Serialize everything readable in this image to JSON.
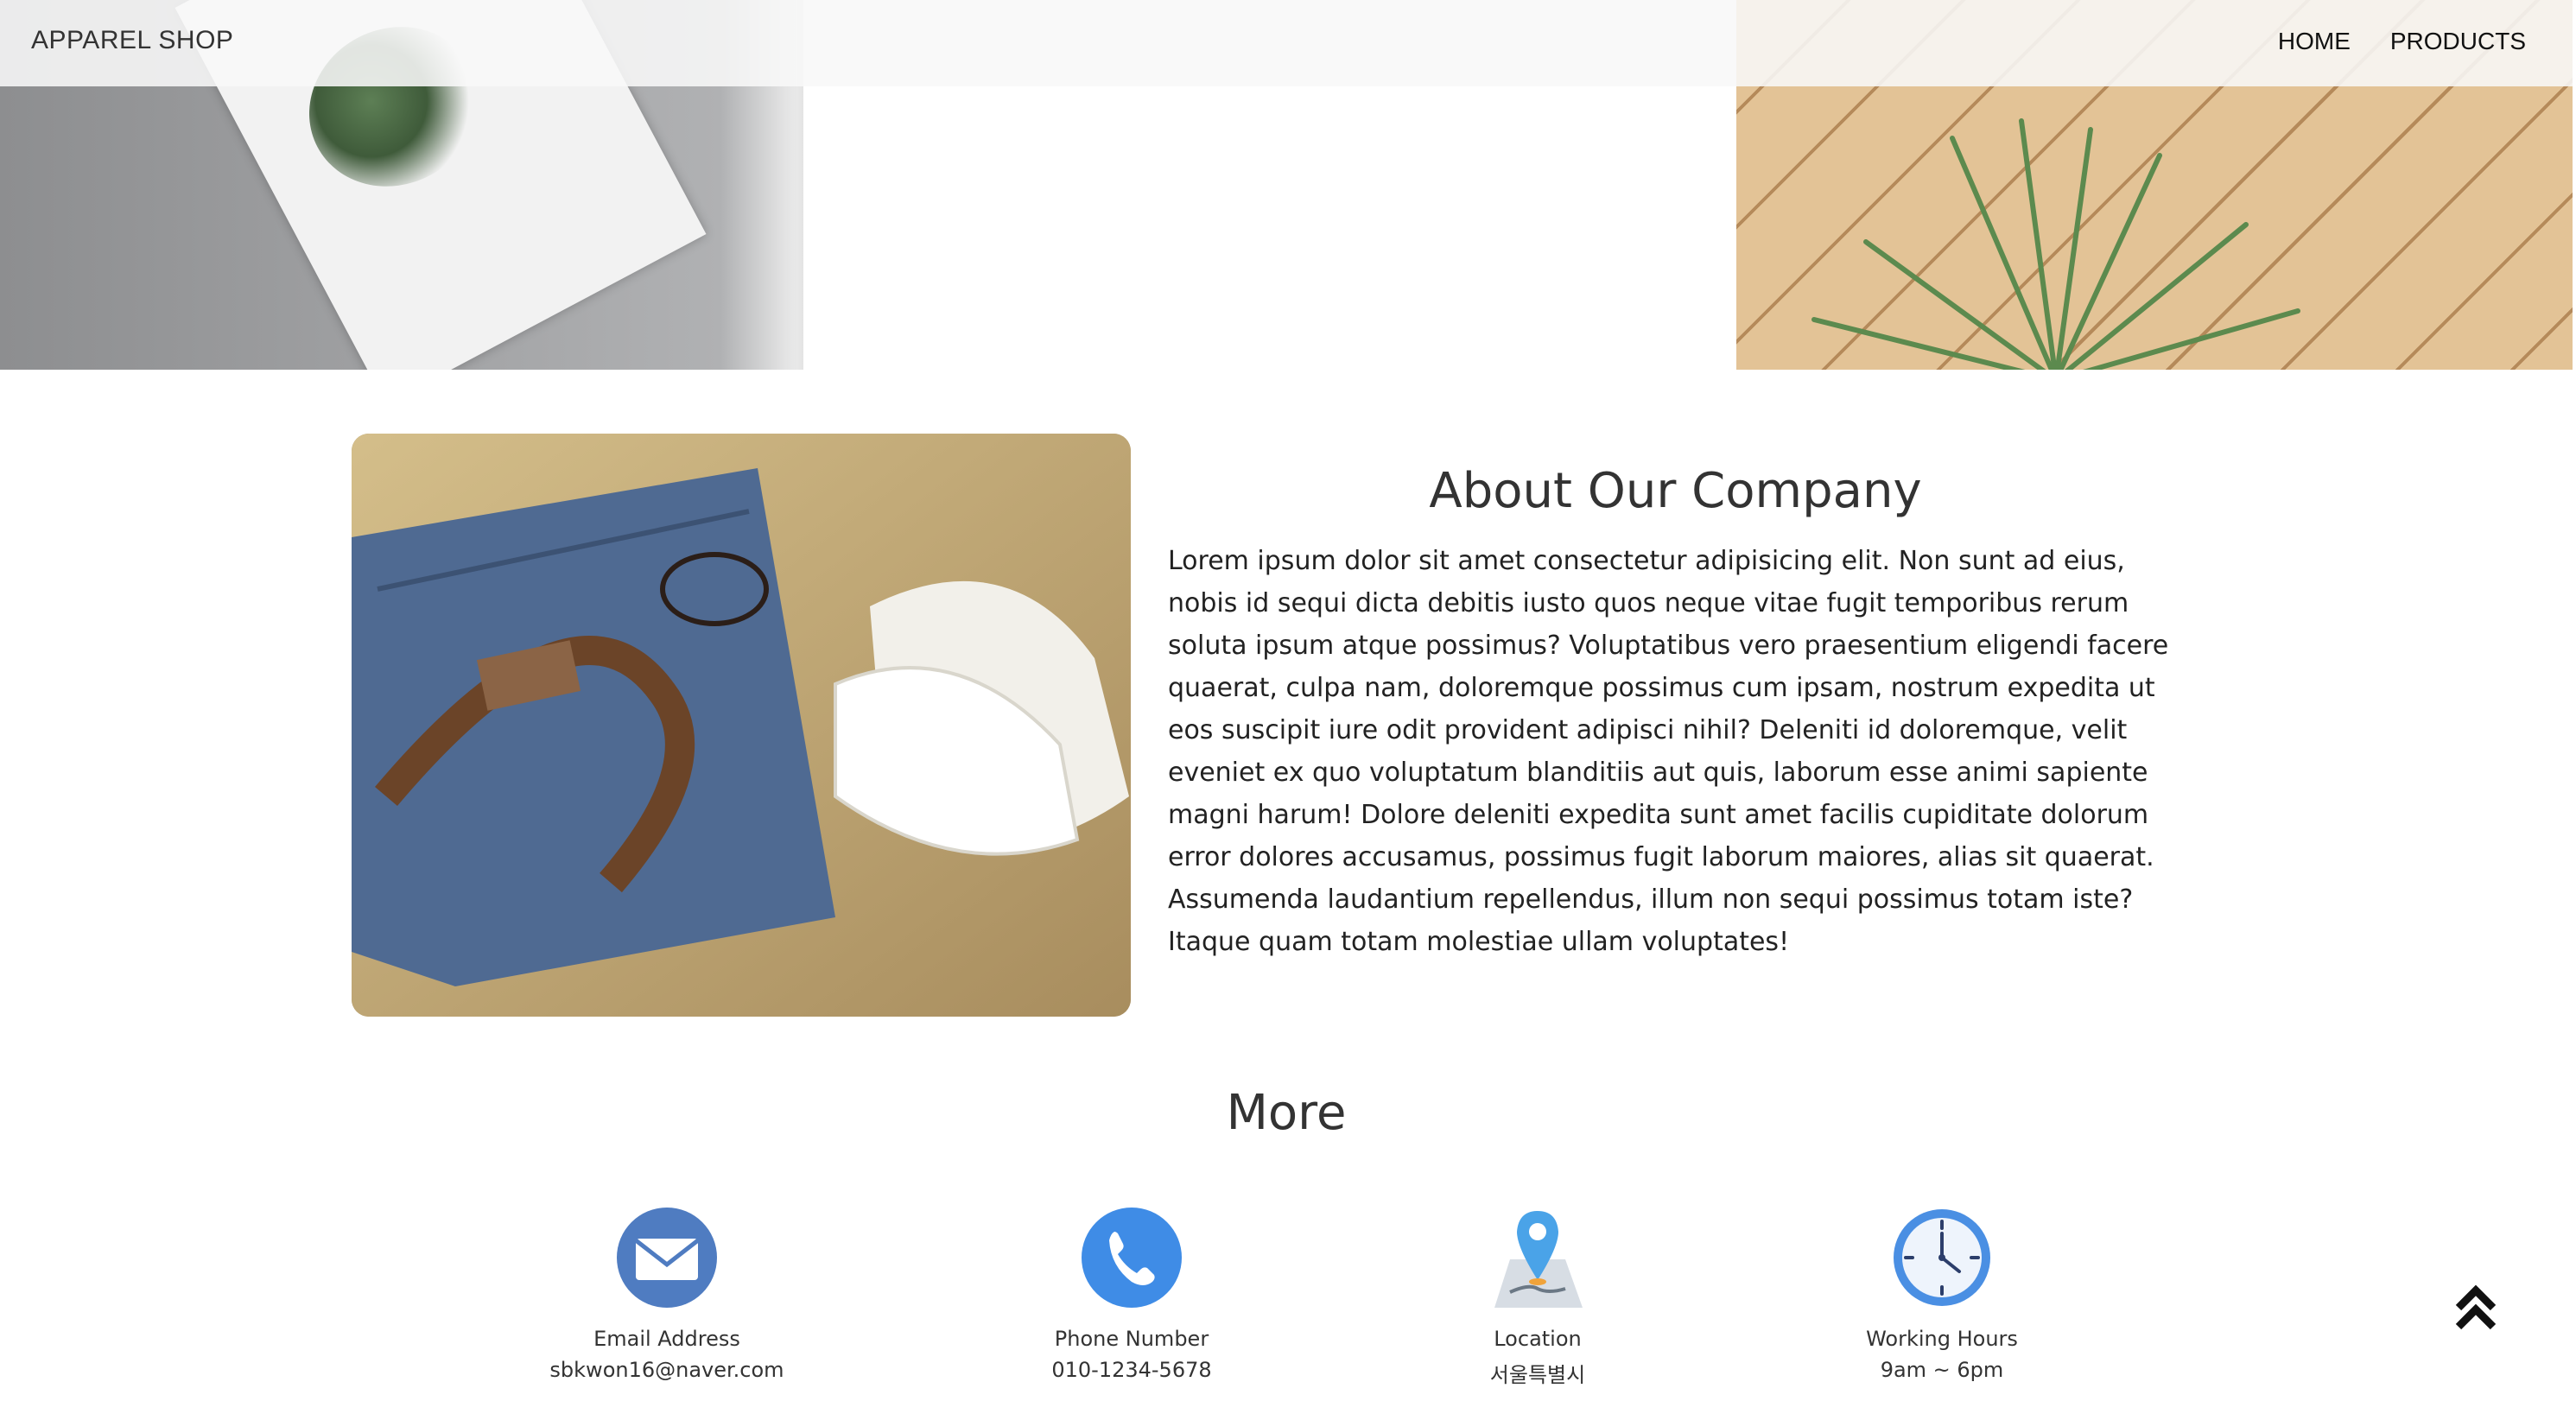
{
  "navbar": {
    "brand": "APPAREL SHOP",
    "links": [
      "HOME",
      "PRODUCTS"
    ]
  },
  "about": {
    "title": "About Our Company",
    "body": "Lorem ipsum dolor sit amet consectetur adipisicing elit. Non sunt ad eius, nobis id sequi dicta debitis iusto quos neque vitae fugit temporibus rerum soluta ipsum atque possimus? Voluptatibus vero praesentium eligendi facere quaerat, culpa nam, doloremque possimus cum ipsam, nostrum expedita ut eos suscipit iure odit provident adipisci nihil? Deleniti id doloremque, velit eveniet ex quo voluptatum blanditiis aut quis, laborum esse animi sapiente magni harum! Dolore deleniti expedita sunt amet facilis cupiditate dolorum error dolores accusamus, possimus fugit laborum maiores, alias sit quaerat. Assumenda laudantium repellendus, illum non sequi possimus totam iste? Itaque quam totam molestiae ullam voluptates!"
  },
  "more": {
    "title": "More",
    "items": [
      {
        "icon": "email-icon",
        "label": "Email Address",
        "value": "sbkwon16@naver.com"
      },
      {
        "icon": "phone-icon",
        "label": "Phone Number",
        "value": "010-1234-5678"
      },
      {
        "icon": "location-icon",
        "label": "Location",
        "value": "서울특별시"
      },
      {
        "icon": "clock-icon",
        "label": "Working Hours",
        "value": "9am ~ 6pm"
      }
    ]
  },
  "colors": {
    "icon_blue": "#4a8fe3",
    "email_blue": "#4f7cc1",
    "text": "#222222"
  },
  "scroll_top_icon": "double-chevron-up-icon"
}
